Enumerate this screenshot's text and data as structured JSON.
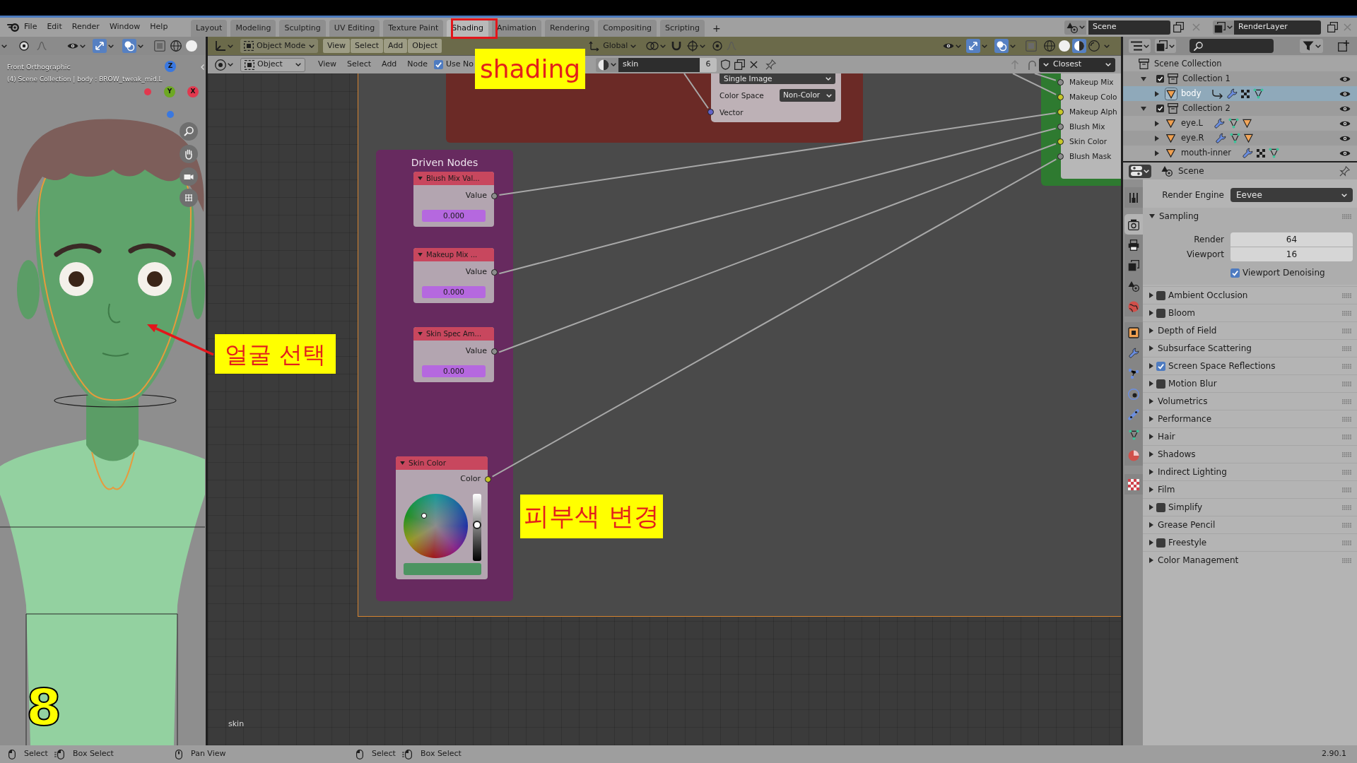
{
  "top_bar": {
    "menus": [
      "File",
      "Edit",
      "Render",
      "Window",
      "Help"
    ],
    "workspaces": [
      {
        "label": "Layout",
        "selected": false
      },
      {
        "label": "Modeling",
        "selected": false
      },
      {
        "label": "Sculpting",
        "selected": false
      },
      {
        "label": "UV Editing",
        "selected": false
      },
      {
        "label": "Texture Paint",
        "selected": false
      },
      {
        "label": "Shading",
        "selected": true
      },
      {
        "label": "Animation",
        "selected": false
      },
      {
        "label": "Rendering",
        "selected": false
      },
      {
        "label": "Compositing",
        "selected": false
      },
      {
        "label": "Scripting",
        "selected": false
      }
    ],
    "add_workspace": "+",
    "scene": "Scene",
    "view_layer": "RenderLayer"
  },
  "viewport": {
    "view_name": "Front Orthographic",
    "context": "(4) Scene Collection | body : BROW_tweak_mid.L",
    "gizmo_axes": [
      {
        "label": "Z",
        "color": "#3a78e0"
      },
      {
        "label": "Y",
        "color": "#6da823"
      },
      {
        "label": "X",
        "color": "#e2384e"
      }
    ]
  },
  "shading_viewport_header": {
    "mode": "Object Mode",
    "menus": [
      "View",
      "Select",
      "Add",
      "Object"
    ],
    "orientation": "Global"
  },
  "node_editor": {
    "header": {
      "shader_type": "Object",
      "menus": [
        "View",
        "Select",
        "Add",
        "Node"
      ],
      "use_nodes": {
        "label": "Use No",
        "checked": true
      },
      "material": "skin",
      "users": "6",
      "interpolation": "Closest"
    },
    "image_node": {
      "projection": "Single Image",
      "color_space_label": "Color Space",
      "color_space": "Non-Color",
      "input": "Vector"
    },
    "group_node": {
      "inputs": [
        {
          "label": "Makeup Mix",
          "kind": "float"
        },
        {
          "label": "Makeup Colo",
          "kind": "color"
        },
        {
          "label": "Makeup Alph",
          "kind": "color"
        },
        {
          "label": "Blush Mix",
          "kind": "float"
        },
        {
          "label": "Skin Color",
          "kind": "color"
        },
        {
          "label": "Blush Mask",
          "kind": "float"
        }
      ]
    },
    "driven_frame": {
      "title": "Driven Nodes",
      "value_nodes": [
        {
          "title": "Blush Mix Val...",
          "output": "Value",
          "value": "0.000"
        },
        {
          "title": "Makeup Mix ...",
          "output": "Value",
          "value": "0.000"
        },
        {
          "title": "Skin Spec Am...",
          "output": "Value",
          "value": "0.000"
        }
      ],
      "color_node": {
        "title": "Skin Color",
        "output": "Color",
        "value_slider": {
          "level": 0.54
        },
        "color": "#4c9461"
      }
    },
    "material_label": "skin"
  },
  "outliner": {
    "tree": [
      {
        "label": "Scene Collection",
        "kind": "scene_collection",
        "selected": false,
        "children": [
          {
            "label": "Collection 1",
            "kind": "collection",
            "expanded": true,
            "checked": true,
            "selected": false,
            "children": [
              {
                "label": "body",
                "kind": "mesh",
                "expanded": false,
                "selected": true
              }
            ]
          },
          {
            "label": "Collection 2",
            "kind": "collection",
            "expanded": true,
            "checked": true,
            "selected": false,
            "children": [
              {
                "label": "eye.L",
                "kind": "mesh",
                "expanded": false,
                "selected": false
              },
              {
                "label": "eye.R",
                "kind": "mesh",
                "expanded": false,
                "selected": false
              },
              {
                "label": "mouth-inner",
                "kind": "mesh",
                "expanded": false,
                "selected": false
              }
            ]
          }
        ]
      }
    ]
  },
  "properties": {
    "tabs": [
      {
        "selected": false
      },
      {
        "selected": true
      },
      {
        "selected": false
      },
      {
        "selected": false
      },
      {
        "selected": false
      },
      {
        "selected": false
      },
      {
        "selected": false
      },
      {
        "selected": false
      },
      {
        "selected": false
      },
      {
        "selected": false
      },
      {
        "selected": false
      },
      {
        "selected": false
      },
      {
        "selected": false
      },
      {
        "selected": false
      }
    ],
    "context": "Scene",
    "render_engine": {
      "label": "Render Engine",
      "value": "Eevee"
    },
    "sampling": {
      "title": "Sampling",
      "expanded": true,
      "fields": [
        {
          "label": "Render",
          "value": "64"
        },
        {
          "label": "Viewport",
          "value": "16"
        }
      ],
      "denoising": {
        "label": "Viewport Denoising",
        "checked": true
      }
    },
    "panels": [
      {
        "title": "Ambient Occlusion",
        "kind": "toggle",
        "checked": false,
        "expanded": false
      },
      {
        "title": "Bloom",
        "kind": "toggle",
        "checked": false,
        "expanded": false
      },
      {
        "title": "Depth of Field",
        "kind": "plain",
        "expanded": false
      },
      {
        "title": "Subsurface Scattering",
        "kind": "plain",
        "expanded": false
      },
      {
        "title": "Screen Space Reflections",
        "kind": "toggle",
        "checked": true,
        "expanded": false
      },
      {
        "title": "Motion Blur",
        "kind": "toggle",
        "checked": false,
        "expanded": false
      },
      {
        "title": "Volumetrics",
        "kind": "plain",
        "expanded": false
      },
      {
        "title": "Performance",
        "kind": "plain",
        "expanded": false
      },
      {
        "title": "Hair",
        "kind": "plain",
        "expanded": false
      },
      {
        "title": "Shadows",
        "kind": "plain",
        "expanded": false
      },
      {
        "title": "Indirect Lighting",
        "kind": "plain",
        "expanded": false
      },
      {
        "title": "Film",
        "kind": "plain",
        "expanded": false
      },
      {
        "title": "Simplify",
        "kind": "toggle",
        "checked": false,
        "expanded": false
      },
      {
        "title": "Grease Pencil",
        "kind": "plain",
        "expanded": false
      },
      {
        "title": "Freestyle",
        "kind": "toggle",
        "checked": false,
        "expanded": false
      },
      {
        "title": "Color Management",
        "kind": "plain",
        "expanded": false
      }
    ]
  },
  "status_bar": {
    "groups": [
      [
        {
          "label": "Select",
          "kind": "click"
        },
        {
          "label": "Box Select",
          "kind": "drag"
        }
      ],
      [
        {
          "label": "Pan View",
          "kind": "middle"
        }
      ],
      [
        {
          "label": "Select",
          "kind": "click"
        },
        {
          "label": "Box Select",
          "kind": "drag"
        }
      ]
    ],
    "version": "2.90.1"
  },
  "annotations": [
    {
      "kind": "highlight"
    },
    {
      "kind": "label",
      "text": "shading"
    },
    {
      "kind": "callout",
      "text": "얼굴 선택"
    },
    {
      "kind": "label",
      "text": "피부색 변경"
    },
    {
      "kind": "step",
      "text": "8"
    }
  ]
}
